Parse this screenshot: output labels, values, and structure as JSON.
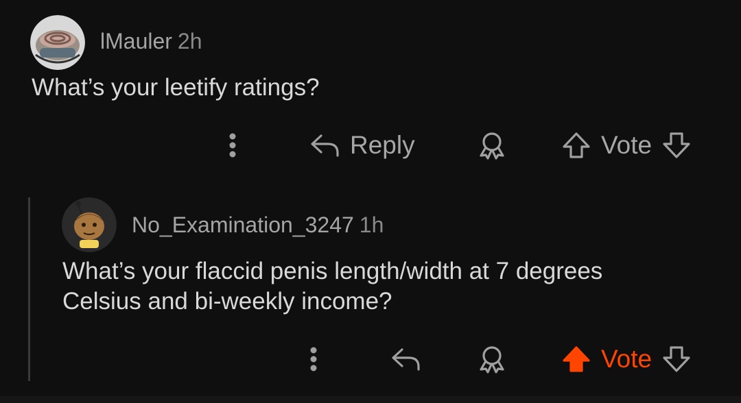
{
  "comments": [
    {
      "username": "lMauler",
      "time": "2h",
      "body": "What’s your leetify ratings?",
      "actions": {
        "reply_label": "Reply",
        "vote_label": "Vote",
        "vote_state": "none"
      }
    },
    {
      "username": "No_Examination_3247",
      "time": "1h",
      "body_lines": [
        "What’s your flaccid penis length/width at 7 degrees",
        "Celsius and bi-weekly income?"
      ],
      "actions": {
        "vote_label": "Vote",
        "vote_state": "upvoted"
      }
    }
  ],
  "colors": {
    "background": "#0f0f0f",
    "text": "#d9d9d9",
    "muted": "#a5a5a5",
    "upvote_orange": "#ff4500"
  },
  "icons": [
    "more-vertical-icon",
    "reply-icon",
    "award-icon",
    "upvote-icon",
    "downvote-icon"
  ]
}
